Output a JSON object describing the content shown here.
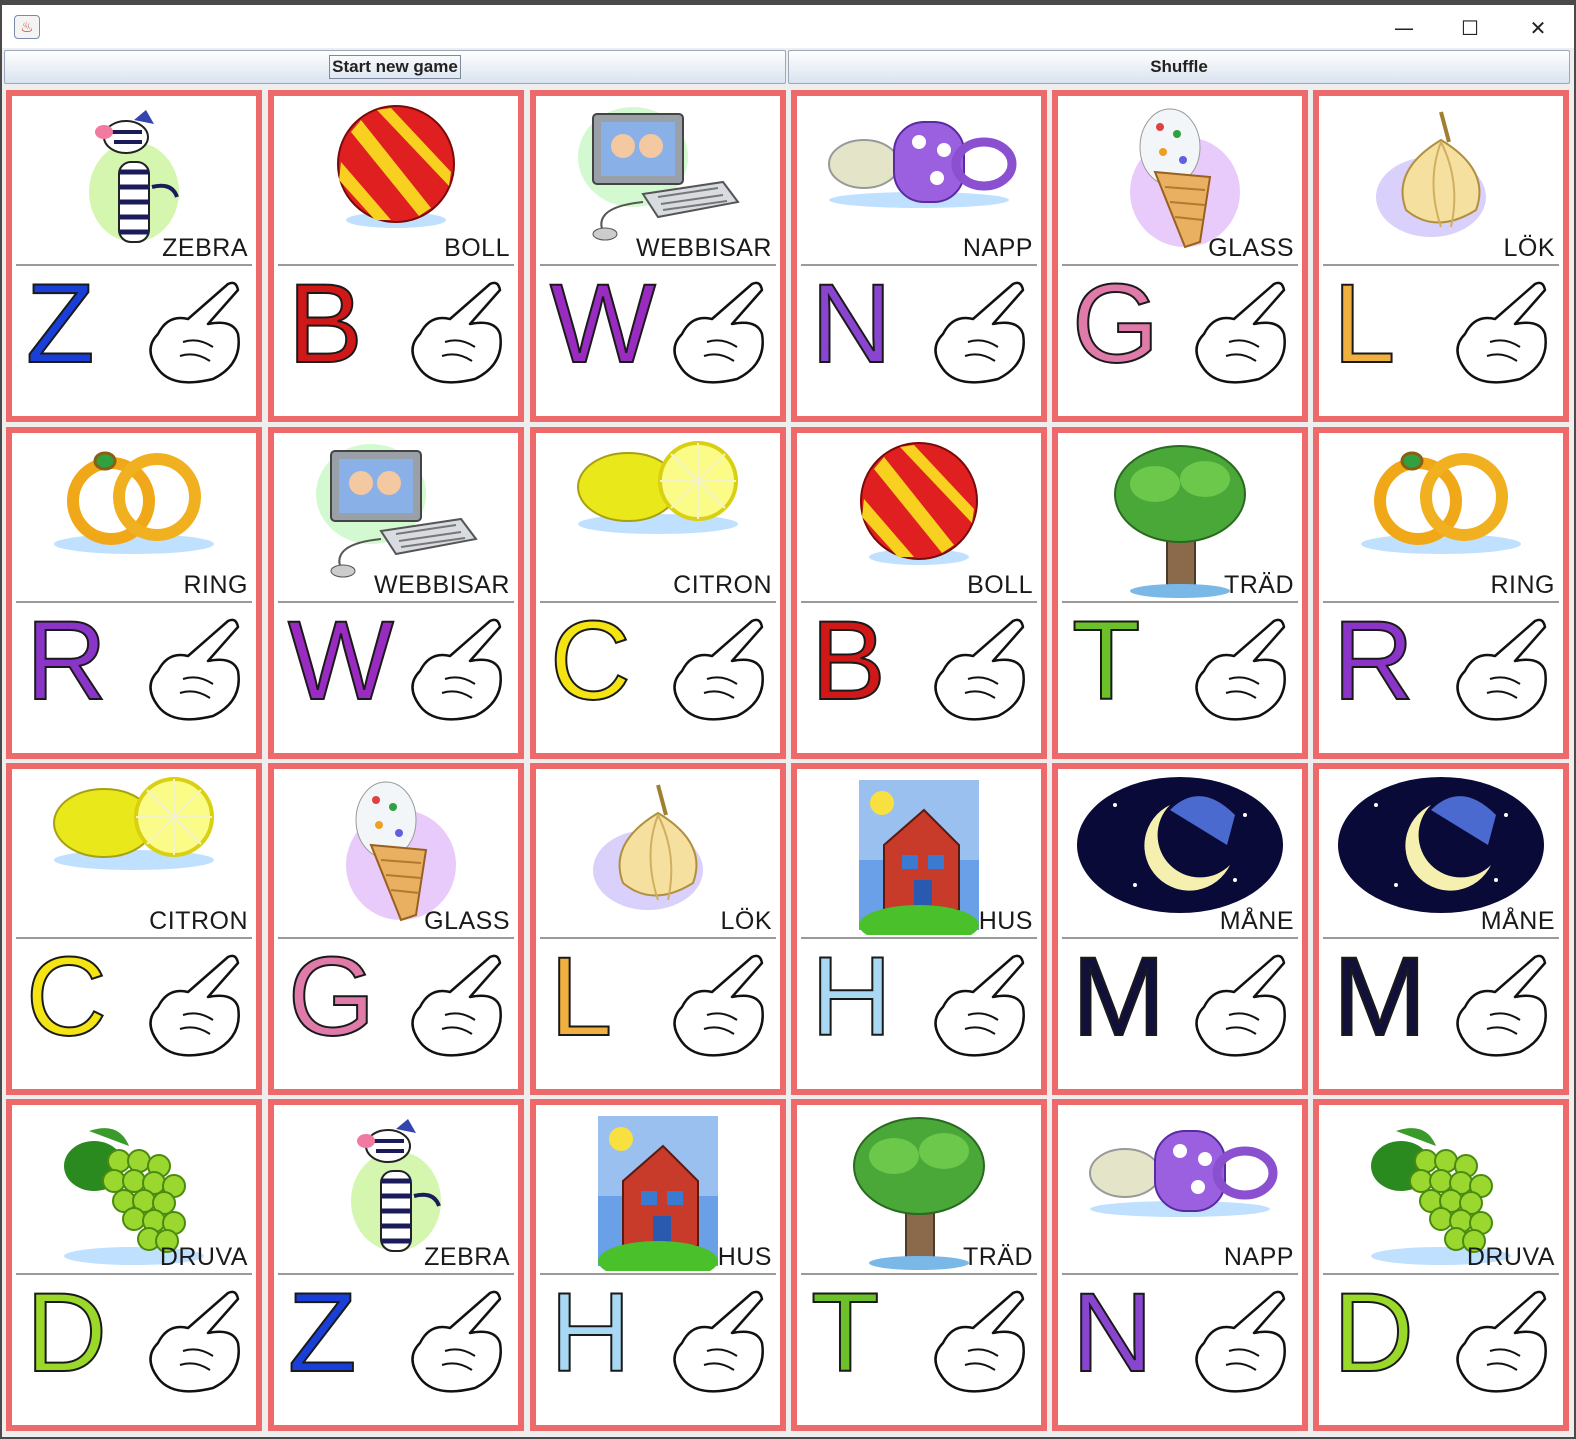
{
  "window": {
    "title": "",
    "controls": {
      "minimize": "—",
      "maximize": "☐",
      "close": "✕"
    }
  },
  "toolbar": {
    "start_label": "Start new game",
    "shuffle_label": "Shuffle"
  },
  "cards": [
    {
      "word": "ZEBRA",
      "letter": "Z",
      "letter_color": "#1a3fd8",
      "picture": "zebra-icon",
      "hand": "hand-sign-icon"
    },
    {
      "word": "BOLL",
      "letter": "B",
      "letter_color": "#d01818",
      "picture": "ball-icon",
      "hand": "hand-sign-icon"
    },
    {
      "word": "WEBBISAR",
      "letter": "W",
      "letter_color": "#9a2bc0",
      "picture": "computer-icon",
      "hand": "hand-sign-icon"
    },
    {
      "word": "NAPP",
      "letter": "N",
      "letter_color": "#8a45d0",
      "picture": "pacifier-icon",
      "hand": "hand-sign-icon"
    },
    {
      "word": "GLASS",
      "letter": "G",
      "letter_color": "#e07aa8",
      "picture": "ice-cream-icon",
      "hand": "hand-sign-icon"
    },
    {
      "word": "LÖK",
      "letter": "L",
      "letter_color": "#f0b040",
      "picture": "onion-icon",
      "hand": "hand-sign-icon"
    },
    {
      "word": "RING",
      "letter": "R",
      "letter_color": "#8a35c8",
      "picture": "rings-icon",
      "hand": "hand-sign-icon"
    },
    {
      "word": "WEBBISAR",
      "letter": "W",
      "letter_color": "#9a2bc0",
      "picture": "computer-icon",
      "hand": "hand-sign-icon"
    },
    {
      "word": "CITRON",
      "letter": "C",
      "letter_color": "#f4e414",
      "picture": "lemon-icon",
      "hand": "hand-sign-icon"
    },
    {
      "word": "BOLL",
      "letter": "B",
      "letter_color": "#d01818",
      "picture": "ball-icon",
      "hand": "hand-sign-icon"
    },
    {
      "word": "TRÄD",
      "letter": "T",
      "letter_color": "#6cc02a",
      "picture": "tree-icon",
      "hand": "hand-sign-icon"
    },
    {
      "word": "RING",
      "letter": "R",
      "letter_color": "#8a35c8",
      "picture": "rings-icon",
      "hand": "hand-sign-icon"
    },
    {
      "word": "CITRON",
      "letter": "C",
      "letter_color": "#f4e414",
      "picture": "lemon-icon",
      "hand": "hand-sign-icon"
    },
    {
      "word": "GLASS",
      "letter": "G",
      "letter_color": "#e07aa8",
      "picture": "ice-cream-icon",
      "hand": "hand-sign-icon"
    },
    {
      "word": "LÖK",
      "letter": "L",
      "letter_color": "#f0b040",
      "picture": "onion-icon",
      "hand": "hand-sign-icon"
    },
    {
      "word": "HUS",
      "letter": "H",
      "letter_color": "#a8d8f4",
      "picture": "house-icon",
      "hand": "hand-sign-icon"
    },
    {
      "word": "MÅNE",
      "letter": "M",
      "letter_color": "#10103a",
      "picture": "moon-icon",
      "hand": "hand-sign-icon"
    },
    {
      "word": "MÅNE",
      "letter": "M",
      "letter_color": "#10103a",
      "picture": "moon-icon",
      "hand": "hand-sign-icon"
    },
    {
      "word": "DRUVA",
      "letter": "D",
      "letter_color": "#9ad82a",
      "picture": "grapes-icon",
      "hand": "hand-sign-icon"
    },
    {
      "word": "ZEBRA",
      "letter": "Z",
      "letter_color": "#1a3fd8",
      "picture": "zebra-icon",
      "hand": "hand-sign-icon"
    },
    {
      "word": "HUS",
      "letter": "H",
      "letter_color": "#a8d8f4",
      "picture": "house-icon",
      "hand": "hand-sign-icon"
    },
    {
      "word": "TRÄD",
      "letter": "T",
      "letter_color": "#6cc02a",
      "picture": "tree-icon",
      "hand": "hand-sign-icon"
    },
    {
      "word": "NAPP",
      "letter": "N",
      "letter_color": "#8a45d0",
      "picture": "pacifier-icon",
      "hand": "hand-sign-icon"
    },
    {
      "word": "DRUVA",
      "letter": "D",
      "letter_color": "#9ad82a",
      "picture": "grapes-icon",
      "hand": "hand-sign-icon"
    }
  ],
  "colors": {
    "card_border": "#ee6a6a",
    "button_gradient_top": "#ffffff",
    "button_gradient_bottom": "#d9e3ef"
  }
}
